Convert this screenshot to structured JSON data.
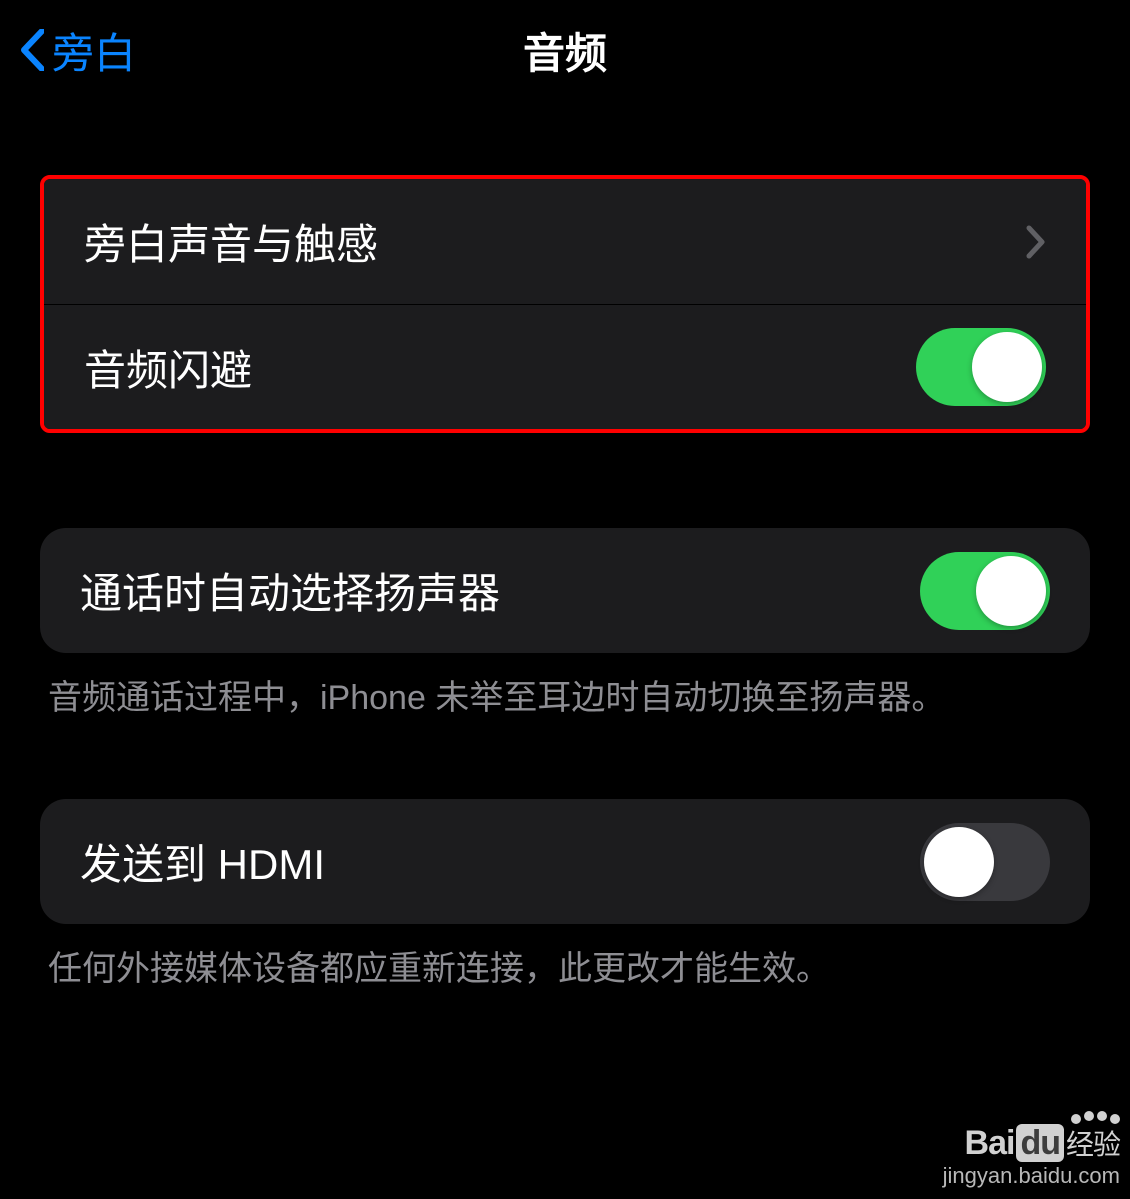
{
  "nav": {
    "back_label": "旁白",
    "title": "音频"
  },
  "group1": {
    "row1": {
      "label": "旁白声音与触感"
    },
    "row2": {
      "label": "音频闪避",
      "toggle": true
    }
  },
  "group2": {
    "row1": {
      "label": "通话时自动选择扬声器",
      "toggle": true
    },
    "footer": "音频通话过程中，iPhone 未举至耳边时自动切换至扬声器。"
  },
  "group3": {
    "row1": {
      "label": "发送到 HDMI",
      "toggle": false
    },
    "footer": "任何外接媒体设备都应重新连接，此更改才能生效。"
  },
  "watermark": {
    "brand_a": "Bai",
    "brand_b": "du",
    "brand_c": "经验",
    "url": "jingyan.baidu.com"
  }
}
